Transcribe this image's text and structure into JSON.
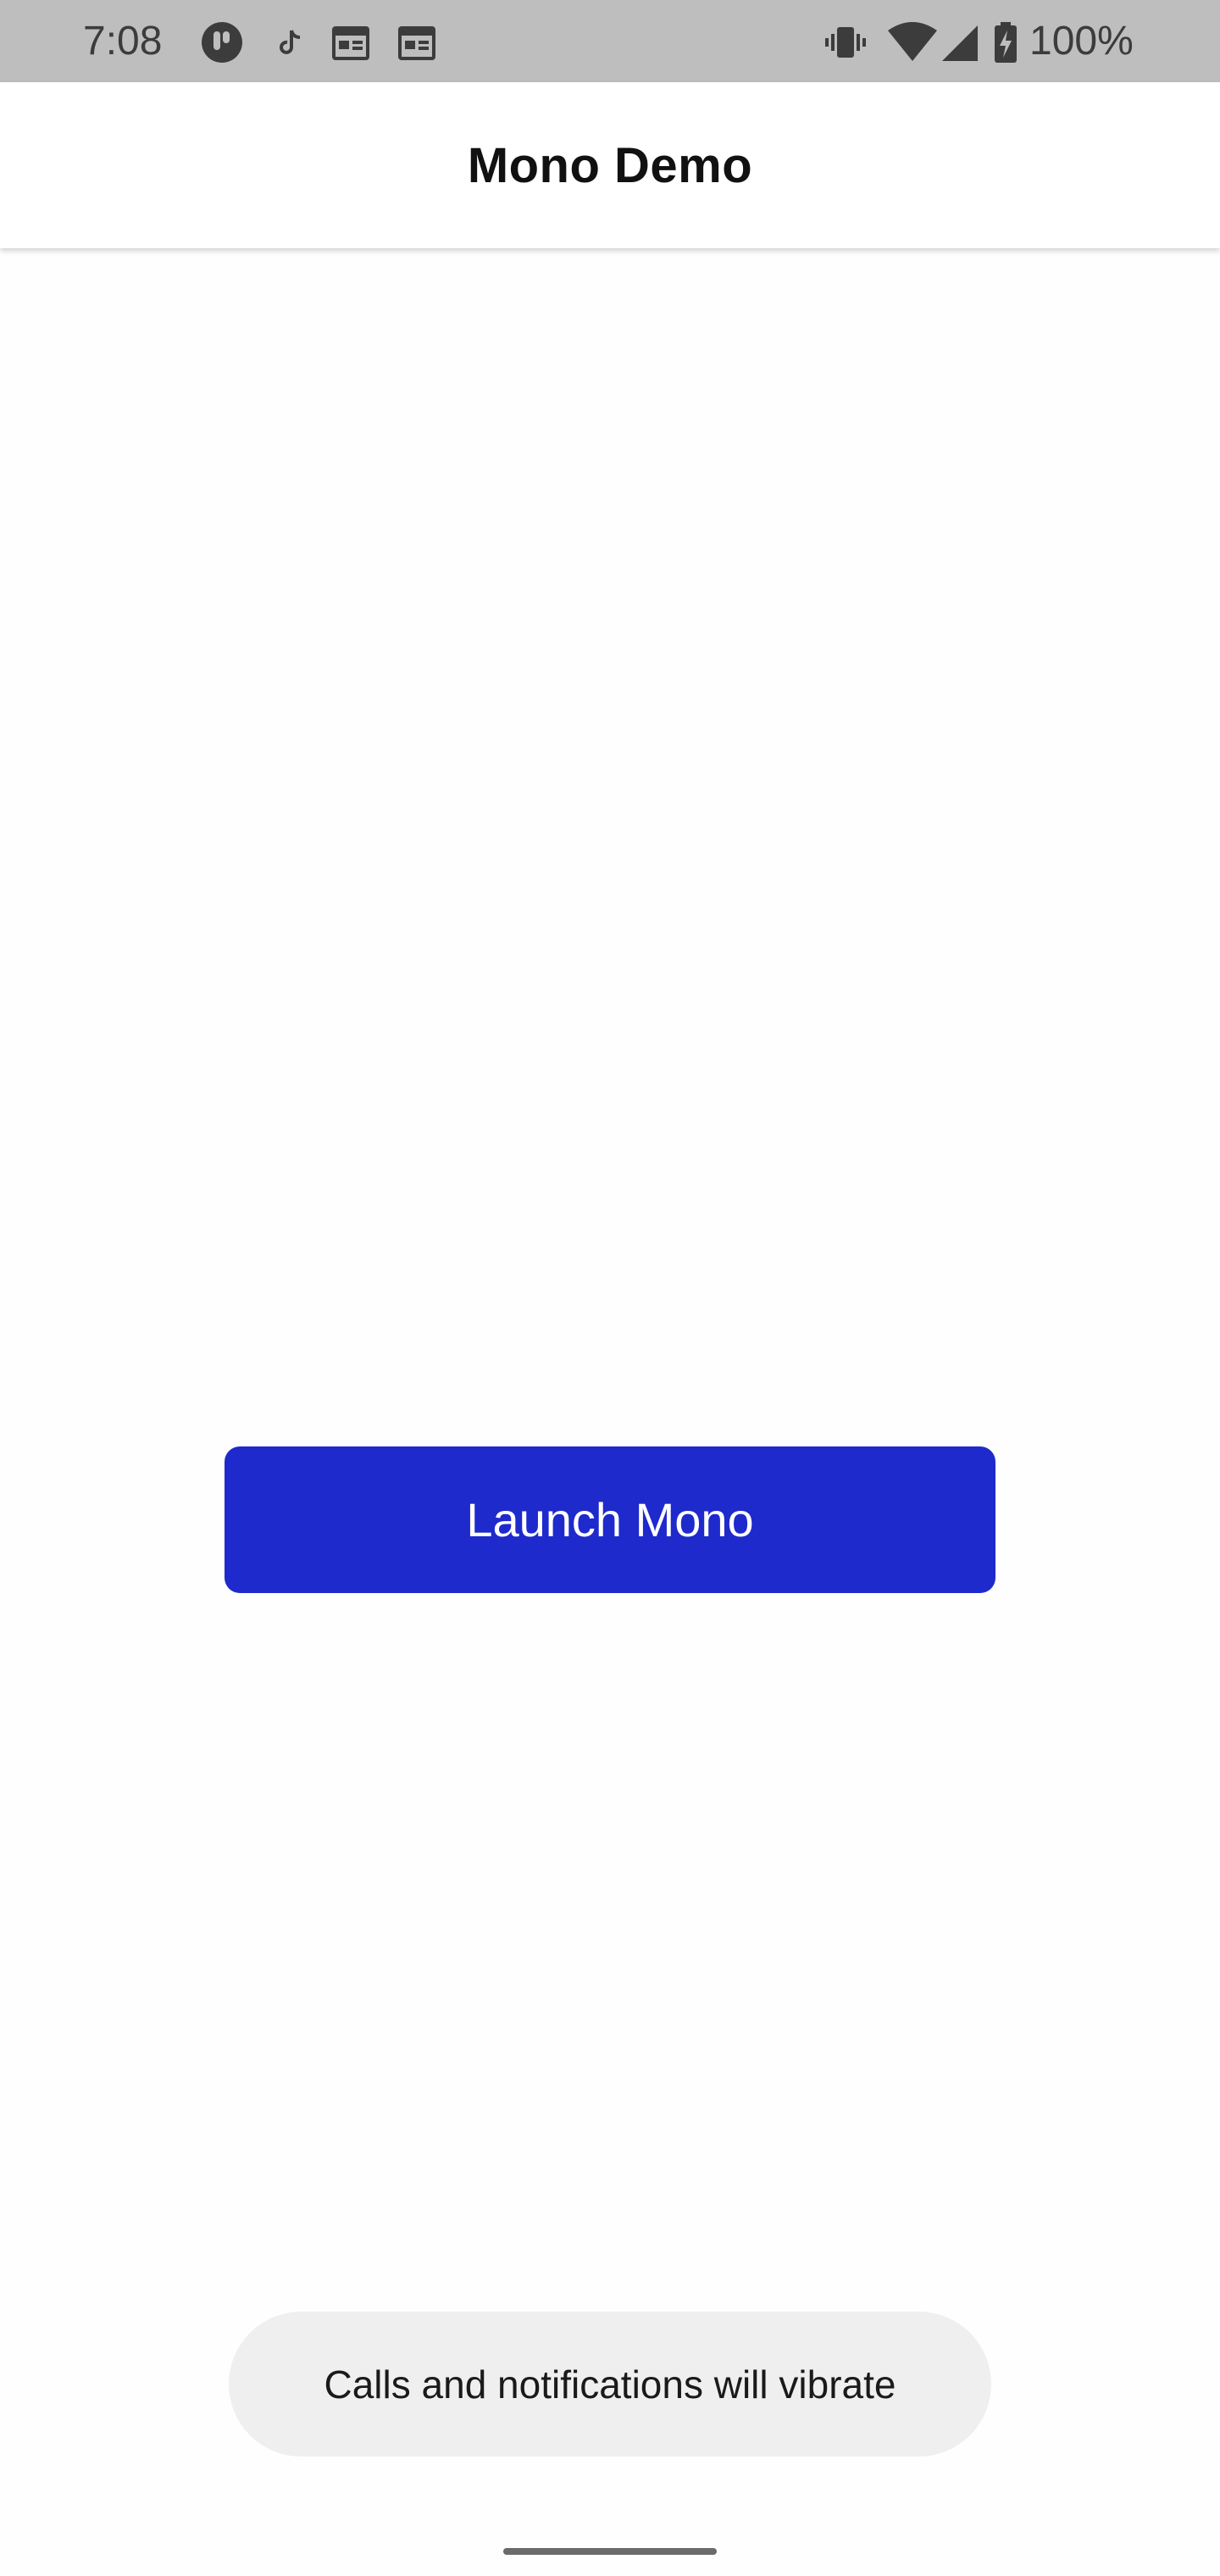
{
  "status_bar": {
    "time": "7:08",
    "battery_percent": "100%",
    "notification_icons": [
      "app-circle-icon",
      "tiktok-icon",
      "calendar-icon",
      "calendar-icon"
    ],
    "system_icons": [
      "vibrate-icon",
      "wifi-icon",
      "cell-signal-icon",
      "battery-charging-icon"
    ]
  },
  "app_bar": {
    "title": "Mono Demo"
  },
  "main": {
    "launch_label": "Launch Mono"
  },
  "toast": {
    "message": "Calls and notifications will vibrate"
  },
  "colors": {
    "status_bar": "#bebebe",
    "button": "#1e2acc",
    "toast_bg": "#efefef"
  }
}
